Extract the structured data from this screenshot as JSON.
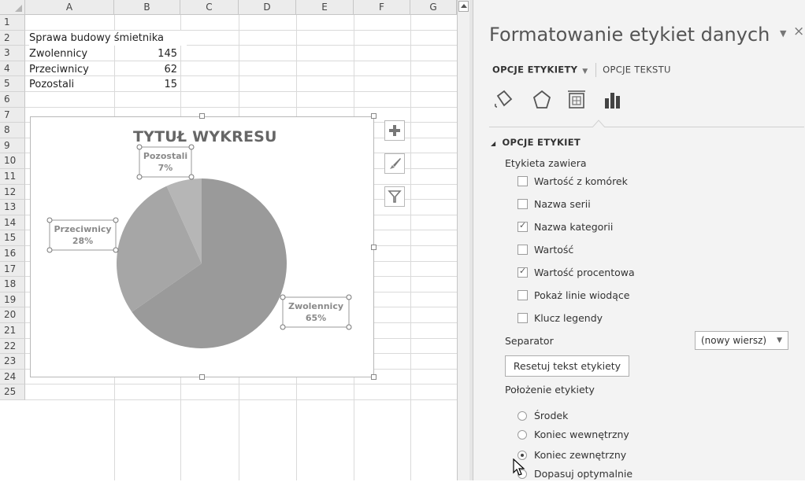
{
  "sheet": {
    "columns": [
      "A",
      "B",
      "C",
      "D",
      "E",
      "F",
      "G"
    ],
    "rows": [
      "1",
      "2",
      "3",
      "4",
      "5",
      "6",
      "7",
      "8",
      "9",
      "10",
      "11",
      "12",
      "13",
      "14",
      "15",
      "16",
      "17",
      "18",
      "19",
      "20",
      "21",
      "22",
      "23",
      "24",
      "25"
    ],
    "cells": {
      "a1": "Sprawa budowy śmietnika",
      "a2": "Zwolennicy",
      "b2": "145",
      "a3": "Przeciwnicy",
      "b3": "62",
      "a4": "Pozostali",
      "b4": "15"
    }
  },
  "chart_data": {
    "type": "pie",
    "title": "TYTUŁ WYKRESU",
    "categories": [
      "Zwolennicy",
      "Przeciwnicy",
      "Pozostali"
    ],
    "values": [
      145,
      62,
      15
    ],
    "labels": [
      {
        "category": "Zwolennicy",
        "percent": "65%"
      },
      {
        "category": "Przeciwnicy",
        "percent": "28%"
      },
      {
        "category": "Pozostali",
        "percent": "7%"
      }
    ],
    "colors": [
      "#9a9a9a",
      "#a6a6a6",
      "#b6b6b6"
    ],
    "legend": "none"
  },
  "pane": {
    "title": "Formatowanie etykiet danych",
    "tabs": {
      "active": "OPCJE ETYKIETY",
      "inactive": "OPCJE TEKSTU"
    },
    "icons": [
      "fill-line-icon",
      "effects-icon",
      "size-properties-icon",
      "bar-chart-options-icon"
    ],
    "section": "OPCJE ETYKIET",
    "contains_label": "Etykieta zawiera",
    "checkboxes": [
      {
        "label": "Wartość z komórek",
        "checked": false
      },
      {
        "label": "Nazwa serii",
        "checked": false
      },
      {
        "label": "Nazwa kategorii",
        "checked": true
      },
      {
        "label": "Wartość",
        "checked": false
      },
      {
        "label": "Wartość procentowa",
        "checked": true
      },
      {
        "label": "Pokaż linie wiodące",
        "checked": false
      },
      {
        "label": "Klucz legendy",
        "checked": false
      }
    ],
    "separator_label": "Separator",
    "separator_value": "(nowy wiersz)",
    "reset_label": "Resetuj tekst etykiety",
    "position_label": "Położenie etykiety",
    "radios": [
      {
        "label": "Środek",
        "selected": false
      },
      {
        "label": "Koniec wewnętrzny",
        "selected": false
      },
      {
        "label": "Koniec zewnętrzny",
        "selected": true
      },
      {
        "label": "Dopasuj optymalnie",
        "selected": false
      }
    ]
  }
}
